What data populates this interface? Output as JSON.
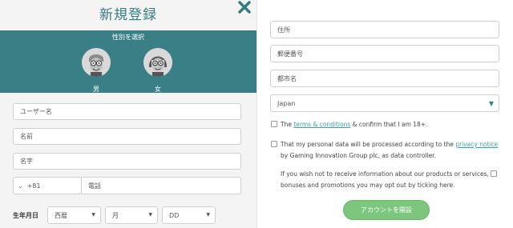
{
  "header": {
    "title": "新規登録"
  },
  "gender": {
    "label": "性別を選択",
    "male": "男",
    "female": "女"
  },
  "fields": {
    "username": "ユーザー名",
    "first_name": "名前",
    "last_name": "名字",
    "country_code": "+81",
    "phone": "電話"
  },
  "dob": {
    "label": "生年月日",
    "era": "西暦",
    "month": "月",
    "day": "DD"
  },
  "address": {
    "address": "住所",
    "postcode": "郵便番号",
    "city": "都市名",
    "country": "Japan"
  },
  "consent": {
    "terms_pre": "The ",
    "terms_link": "terms & conditions",
    "terms_post": " & confirm that I am 18+.",
    "privacy_pre": "That my personal data will be processed according to the ",
    "privacy_link": "privacy notice",
    "privacy_post": " by Gaming Innovation Group plc, as data controller.",
    "optout": "If you wish not to receive information about our products or services, bonuses and promotions you may opt out by ticking here."
  },
  "submit_label": "アカウントを開設",
  "colors": {
    "teal": "#3a7e86",
    "green": "#7dc67e",
    "link": "#3a9fa8"
  },
  "icons": {
    "close": "close-icon",
    "country_chevron": "chevron-down-icon",
    "dropdown": "caret-down-icon"
  }
}
